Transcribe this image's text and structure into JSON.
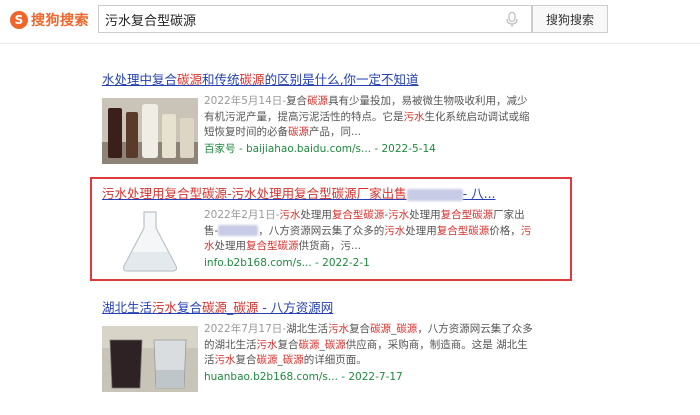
{
  "header": {
    "logo_text": "搜狗搜索",
    "logo_mark": "S",
    "search_value": "污水复合型碳源",
    "search_button": "搜狗搜索"
  },
  "results": [
    {
      "title_parts": [
        "水处理中复合",
        "碳源",
        "和传统",
        "碳源",
        "的区别是什么,你一定不知道"
      ],
      "snippet_date": "2022年5月14日-",
      "snippet_parts": [
        "复合",
        "碳源",
        "具有少量投加，易被微生物吸收利用，减少有机污泥产量，提高污泥活性的特点。它是",
        "污水",
        "生化系统启动调试或缩短恢复时间的必备",
        "碳源",
        "产品，同..."
      ],
      "url": "百家号 - baijiahao.baidu.com/s... - 2022-5-14"
    },
    {
      "title_parts": [
        "污水",
        "处理用",
        "复合型碳源",
        "-",
        "污水",
        "处理用",
        "复合型碳源",
        "厂家出售",
        "- 八..."
      ],
      "snippet_date": "2022年2月1日-",
      "snippet_parts": [
        "污水",
        "处理用",
        "复合型碳源",
        "-",
        "污水",
        "处理用",
        "复合型碳源",
        "厂家出售-",
        "，八方资源网云集了众多的",
        "污水",
        "处理用",
        "复合型碳源",
        "价格，",
        "污水",
        "处理用",
        "复合型碳源",
        "供货商，污..."
      ],
      "url": "info.b2b168.com/s... - 2022-2-1"
    },
    {
      "title_parts": [
        "湖北生活",
        "污水",
        "复合",
        "碳源",
        "_",
        "碳源",
        " - 八方资源网"
      ],
      "snippet_date": "2022年7月17日-",
      "snippet_parts": [
        "湖北生活",
        "污水",
        "复合",
        "碳源",
        "_",
        "碳源",
        "，八方资源网云集了众多的湖北生活",
        "污水",
        "复合",
        "碳源",
        "_",
        "碳源",
        "供应商，采购商，制造商。这是 湖北生活",
        "污水",
        "复合",
        "碳源",
        "_",
        "碳源",
        "的详细页面。"
      ],
      "url": "huanbao.b2b168.com/s... - 2022-7-17"
    }
  ],
  "colors": {
    "brand": "#f0662a",
    "link": "#2440b3",
    "keyword_highlight": "#d8302c",
    "url_green": "#1e8a3e",
    "annotation_box": "#e03a3a"
  },
  "icons": [
    "sogou-logo-icon",
    "microphone-icon"
  ]
}
